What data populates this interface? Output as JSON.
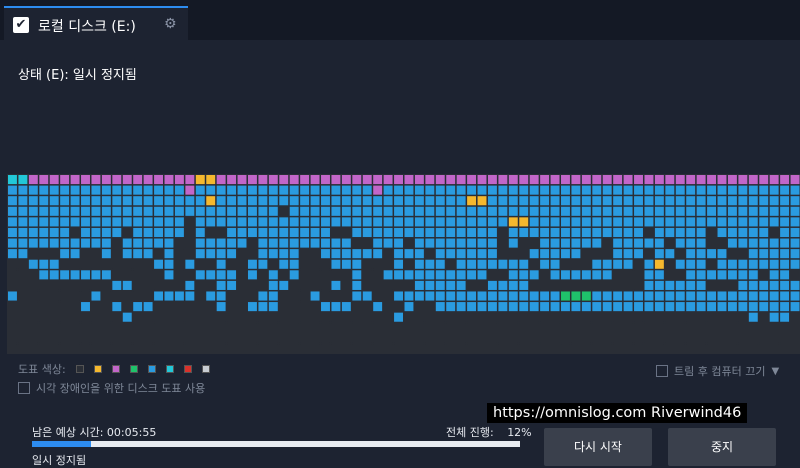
{
  "tab": {
    "title": "로컬 디스크 (E:)",
    "checkbox_glyph": "✔",
    "spinner_glyph": "⚙"
  },
  "status": {
    "label": "상태 (E): 일시 정지됨"
  },
  "legend": {
    "label": "도표 색상:",
    "colors": [
      "#2a2e36",
      "#f5b82e",
      "#c266c9",
      "#1fc26b",
      "#2a9be0",
      "#22c8d8",
      "#d9312b",
      "#c8ccd2"
    ]
  },
  "accessibility": {
    "label": "시각 장애인을 위한 디스크 도표 사용"
  },
  "shutdown": {
    "label": "트림 후 컴퓨터 끄기",
    "arrow": "▼"
  },
  "watermark": "https://omnislog.com Riverwind46",
  "time_remaining": "남은 예상 시간: 00:05:55",
  "total_progress": {
    "label": "전체 진행:",
    "value": "12%",
    "fraction": 0.12
  },
  "progress_status": "일시 정지됨",
  "buttons": {
    "restart": "다시 시작",
    "stop": "중지"
  },
  "disk_map": {
    "palette": {
      ".": "#2a2e36",
      "B": "#2a9be0",
      "C": "#22c8d8",
      "P": "#c266c9",
      "Y": "#f5b82e",
      "G": "#1fc26b"
    },
    "rows": [
      "CCPPPPPPPPPPPPPPPPYYPPPPPPPPPPPPPPPPPPPPPPPPPPPPPPPPPPPPPPPPPPPPPPPPPPPPPPPP",
      "BBBBBBBBBBBBBBBBBPBBBBBBBBBBBBBBBBBPBBBBBBBBBBBBBBBBBBBBBBBBBBBBBBBBBBBBBBBB",
      "BBBBBBBBBBBBBBBBBBBYBBBBBBBBBBBBBBBBBBBBBBBBYYBBBBBBBBBBBBBBBBBBBBBBBBBBBBBB",
      "BBBBBBBBBBBBBBBBBBBBBBBBBB.BBBBBBBBBBBBBBBBBBBBBBBBBBBBBBBBBBBBBBBBBBBBBBBBB",
      "BBBBBBBBBBBBBBBBB.BBBBBBBBBBBBBBBBBBBBBBBBBBBBBBYYBBBBBBBBBBBBBBBBBBBBBBBBBB",
      "BBBBBB.BBBB.BBBBB.B..BBBBBBBBBB..BBBBBBBBBBBBBB.BBBBBBBBBBBBB.BBBBB.BBBBB.BB",
      "BBBBBBBBBB.BBBBB..BBBBB.BBBBBBBBB..BBB.BBBBBBBB.B..BBBBBB.BBBBB.BBB..BBBBBBB",
      "BB...BB..B.BBB.B..BBBB..BBBB..BBBBBB.BBB.BBBBBB...BBBBB...BBB.BB.BBBB..BBBBB",
      "..BBB.........BB.B..B..BB.BB...BBB...B.BBB.BBBBBBB.BB...BBBB.BY.BBB.BBBBBBBB",
      "...BBBBBBB.....B..BBBB.B.B.B.....B..BBBBBBBBBB..BBB.BBBBBB...BB..BBBBBBB.BB.",
      "..........BB.....B..BB...BB....B.B.....BBBBB..BBBB...........BBBBBB...BBBBBB",
      "B.......B.....BBBB.BB...BB...B...BB..BBBBBBBBBBBBBBBBGGGBBBBBBBBBBBBBBBBBBBB",
      ".......B..B.BB......B..BBB....BBB..B..B..BBBBBBBBBBBBBBBBBBBBBBBBBBBBBBBBBBB",
      "...........B.........................B.................................B.BB.",
      "............................................................................",
      "............................................................................",
      "............................................................................"
    ]
  }
}
